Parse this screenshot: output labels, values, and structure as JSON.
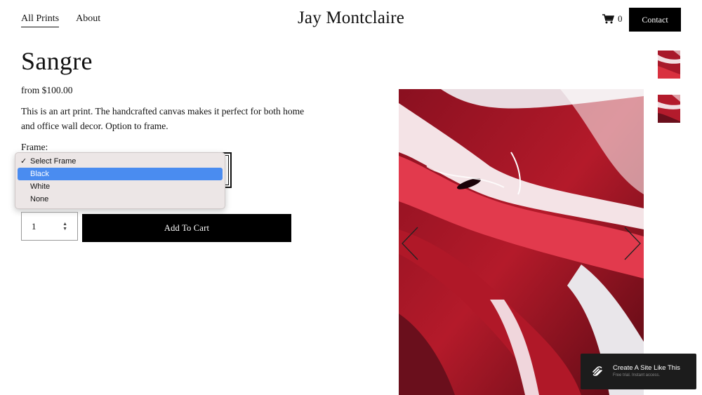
{
  "header": {
    "nav": [
      {
        "label": "All Prints",
        "active": true
      },
      {
        "label": "About",
        "active": false
      }
    ],
    "site_title": "Jay Montclaire",
    "cart_count": "0",
    "contact_label": "Contact"
  },
  "product": {
    "title": "Sangre",
    "price": "from $100.00",
    "description": "This is an art print. The handcrafted canvas makes it perfect for both home and office wall decor. Option to frame.",
    "frame_label": "Frame:",
    "frame_options": [
      "Select Frame",
      "Black",
      "White",
      "None"
    ],
    "frame_checked": "Select Frame",
    "frame_highlighted": "Black",
    "quantity": "1",
    "add_to_cart_label": "Add To Cart"
  },
  "gallery": {
    "thumbnail_count": 2
  },
  "squarespace_badge": {
    "title": "Create A Site Like This",
    "subtitle": "Free trial. Instant access."
  },
  "colors": {
    "primary": "#000000",
    "dropdown_highlight": "#4a8cf0",
    "art_red": "#c4202e"
  }
}
